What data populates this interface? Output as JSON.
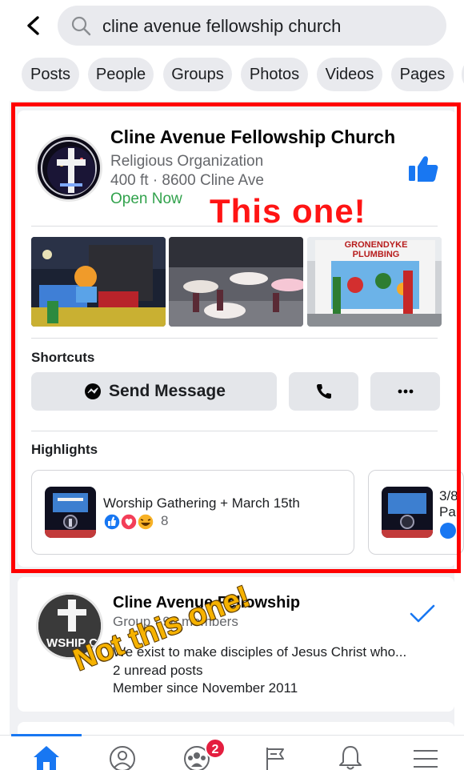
{
  "search": {
    "query": "cline avenue fellowship church"
  },
  "filters": [
    "Posts",
    "People",
    "Groups",
    "Photos",
    "Videos",
    "Pages"
  ],
  "result1": {
    "title": "Cline Avenue Fellowship Church",
    "category": "Religious Organization",
    "location": "400 ft · 8600 Cline Ave",
    "status": "Open Now",
    "shortcuts_label": "Shortcuts",
    "send_message_label": "Send Message",
    "highlights_label": "Highlights",
    "highlights": [
      {
        "title": "Worship Gathering + March 15th",
        "reaction_count": "8"
      },
      {
        "title": "3/8",
        "subtitle": "Pa"
      }
    ],
    "photo_sign_text": "GRONENDYKE PLUMBING"
  },
  "annotation_this": "This one!",
  "result2": {
    "title": "Cline Avenue Fellowship",
    "meta": "Group · 98 members",
    "description": "We exist to make disciples of Jesus Christ who...",
    "unread": "2 unread posts",
    "member_since": "Member since November 2011",
    "avatar_text": "WSHIP C"
  },
  "annotation_not": "Not this one!",
  "nav": {
    "notifications_badge": "2"
  },
  "colors": {
    "accent": "#1877f2",
    "open_green": "#31a24c",
    "annotation_red": "#ff1414",
    "annotation_yellow": "#f6b200",
    "badge_red": "#e41e3f"
  }
}
